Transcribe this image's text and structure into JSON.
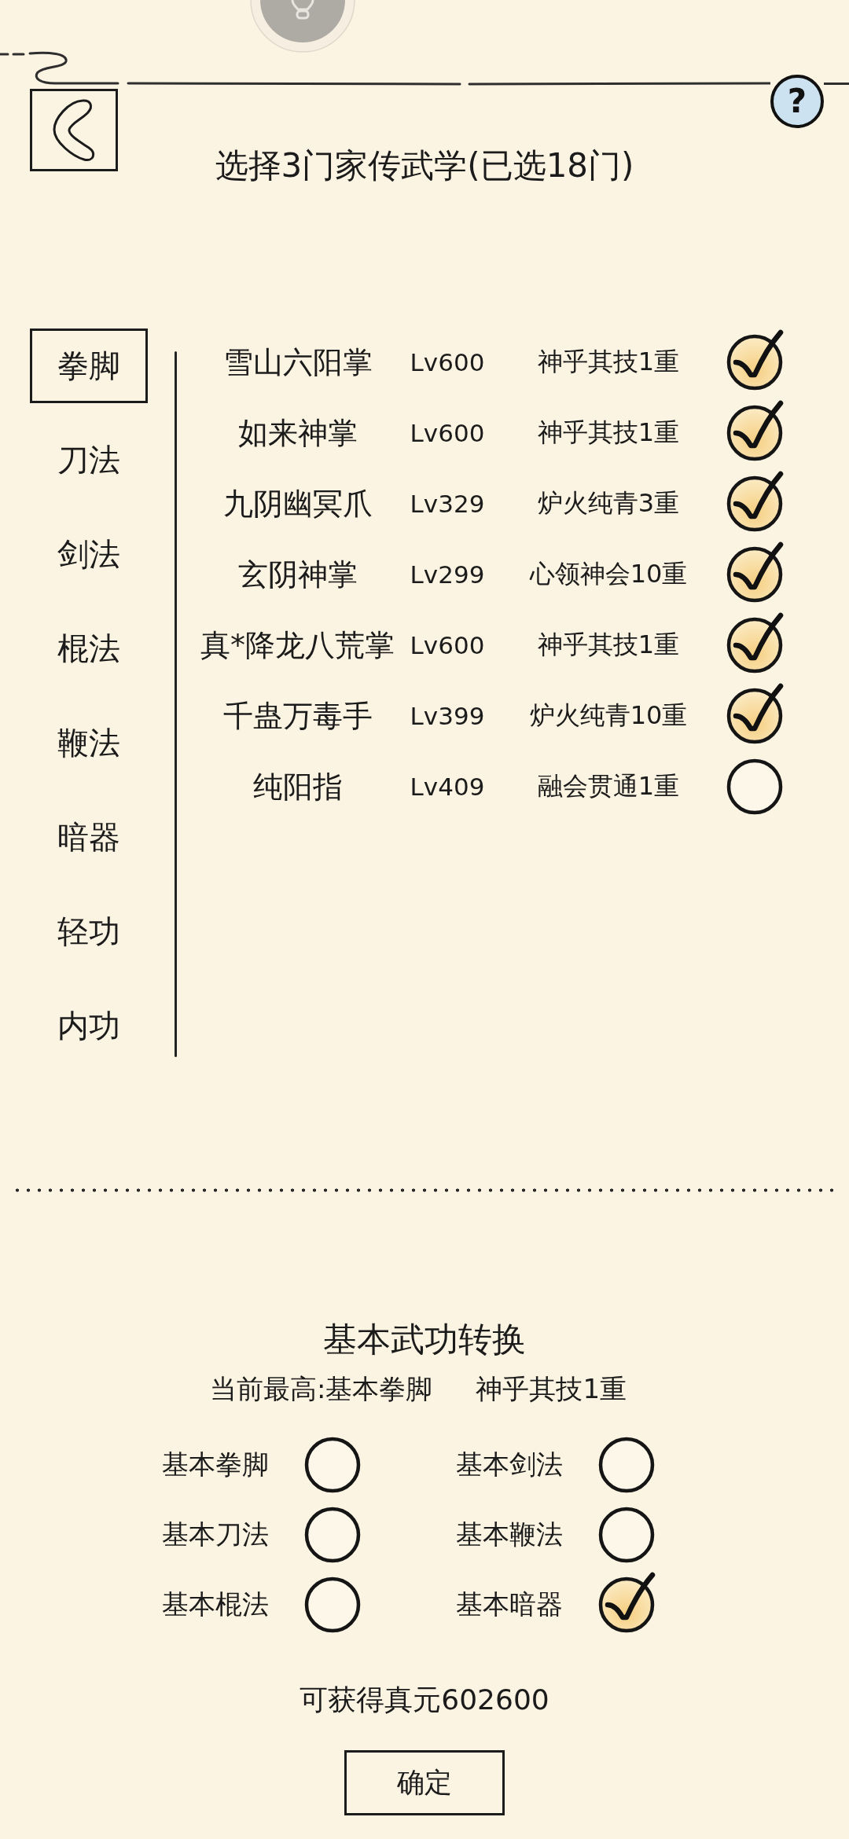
{
  "header": {
    "title": "选择3门家传武学(已选18门)",
    "help_button": "?"
  },
  "categories": [
    {
      "label": "拳脚",
      "selected": true
    },
    {
      "label": "刀法",
      "selected": false
    },
    {
      "label": "剑法",
      "selected": false
    },
    {
      "label": "棍法",
      "selected": false
    },
    {
      "label": "鞭法",
      "selected": false
    },
    {
      "label": "暗器",
      "selected": false
    },
    {
      "label": "轻功",
      "selected": false
    },
    {
      "label": "内功",
      "selected": false
    }
  ],
  "skills": [
    {
      "name": "雪山六阳掌",
      "lv": "Lv600",
      "realm": "神乎其技1重",
      "checked": true
    },
    {
      "name": "如来神掌",
      "lv": "Lv600",
      "realm": "神乎其技1重",
      "checked": true
    },
    {
      "name": "九阴幽冥爪",
      "lv": "Lv329",
      "realm": "炉火纯青3重",
      "checked": true
    },
    {
      "name": "玄阴神掌",
      "lv": "Lv299",
      "realm": "心领神会10重",
      "checked": true
    },
    {
      "name": "真*降龙八荒掌",
      "lv": "Lv600",
      "realm": "神乎其技1重",
      "checked": true
    },
    {
      "name": "千蛊万毒手",
      "lv": "Lv399",
      "realm": "炉火纯青10重",
      "checked": true
    },
    {
      "name": "纯阳指",
      "lv": "Lv409",
      "realm": "融会贯通1重",
      "checked": false
    }
  ],
  "conversion": {
    "title": "基本武功转换",
    "current_best": "当前最高:基本拳脚",
    "current_realm": "神乎其技1重",
    "options": [
      {
        "label": "基本拳脚",
        "selected": false
      },
      {
        "label": "基本剑法",
        "selected": false
      },
      {
        "label": "基本刀法",
        "selected": false
      },
      {
        "label": "基本鞭法",
        "selected": false
      },
      {
        "label": "基本棍法",
        "selected": false
      },
      {
        "label": "基本暗器",
        "selected": true
      }
    ],
    "reward": "可获得真元602600",
    "confirm_button": "确定"
  }
}
